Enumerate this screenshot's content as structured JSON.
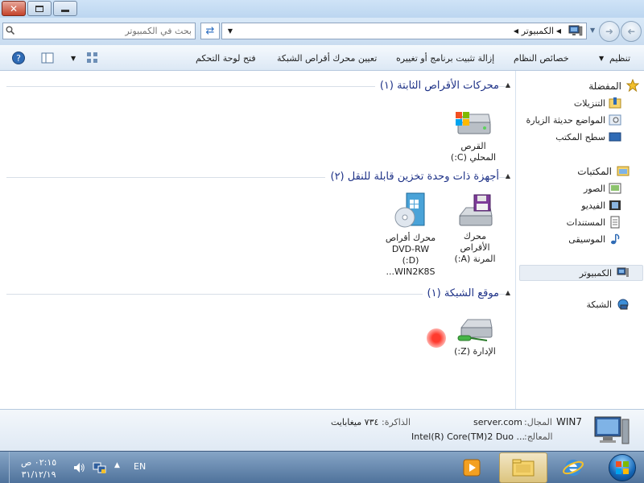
{
  "window": {
    "close_glyph": "✕"
  },
  "addressbar": {
    "search_placeholder": "بحث في الكمبيوتر",
    "path": "الكمبيوتر",
    "refresh_glyph": "⇄",
    "back_glyph": "➜",
    "forward_glyph": "➜"
  },
  "commandbar": {
    "organize": "تنظيم",
    "system_properties": "خصائص النظام",
    "uninstall": "إزالة تثبيت برنامج أو تغييره",
    "map_drive": "تعيين محرك أقراص الشبكة",
    "control_panel": "فتح لوحة التحكم"
  },
  "navpane": {
    "favorites": "المفضلة",
    "downloads": "التنزيلات",
    "recent": "المواضع حديثة الزيارة",
    "desktop": "سطح المكتب",
    "libraries": "المكتبات",
    "pictures": "الصور",
    "videos": "الفيديو",
    "documents": "المستندات",
    "music": "الموسيقى",
    "computer": "الكمبيوتر",
    "network": "الشبكة"
  },
  "groups": {
    "hdd": {
      "title": "محركات الأقراص الثابتة (١)"
    },
    "removable": {
      "title": "أجهزة ذات وحدة تخزين قابلة للنقل (٢)"
    },
    "network": {
      "title": "موقع الشبكة (١)"
    }
  },
  "items": {
    "local_disk": {
      "line1": "القرص",
      "line2": "المحلي (C:)"
    },
    "floppy": {
      "line1": "محرك",
      "line2": "الأقراص",
      "line3": "المرنة (A:)"
    },
    "dvd": {
      "line1": "محرك أقراص",
      "line2": "DVD-RW",
      "line3": "(D:)",
      "line4": "WIN2K8S..."
    },
    "network_drive": {
      "line1": "الإدارة (Z:)"
    }
  },
  "details": {
    "computer_name": "WIN7",
    "domain_label": "المجال:",
    "domain_value": "server.com",
    "memory_label": "الذاكرة:",
    "memory_value": "٧٣٤ ميغابايت",
    "processor_label": "المعالج:",
    "processor_value": "Intel(R) Core(TM)2 Duo ..."
  },
  "taskbar": {
    "time": "٠٢:١٥ ص",
    "date": "٣١/١٢/١٩",
    "language": "EN",
    "tray_arrow": "▲"
  },
  "colors": {
    "group_title": "#1e3287",
    "accent": "#4f729b"
  }
}
